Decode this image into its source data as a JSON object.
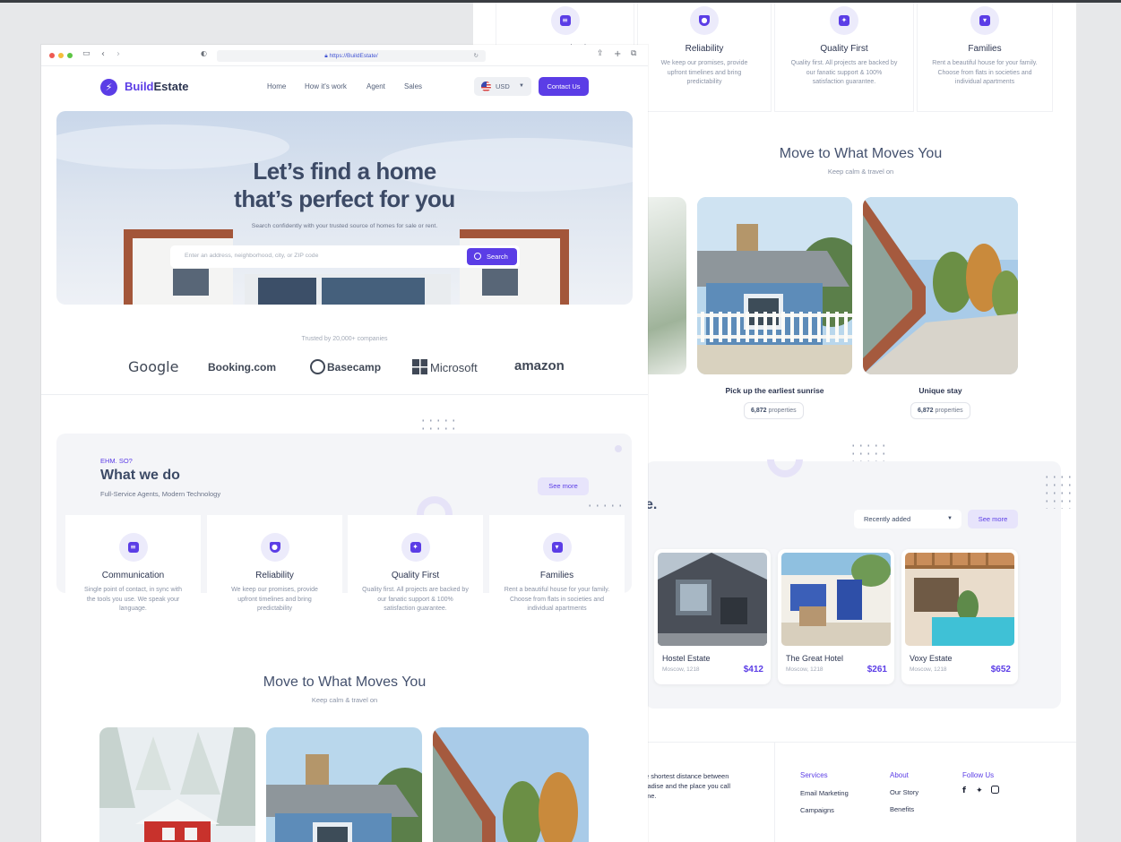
{
  "browser": {
    "url": "https://BuildEstate/"
  },
  "nav": {
    "logo_bold": "Build",
    "logo_rest": "Estate",
    "links": [
      "Home",
      "How it's work",
      "Agent",
      "Sales"
    ],
    "currency": "USD",
    "cta": "Contact Us"
  },
  "hero": {
    "title_line1": "Let’s find a home",
    "title_line2": "that’s perfect for you",
    "subtitle": "Search confidently with your trusted source of homes for sale or rent.",
    "search_placeholder": "Enter an address, neighborhood, city, or ZIP code",
    "search_button": "Search"
  },
  "trusted": {
    "label": "Trusted by 20,000+ companies",
    "brands": [
      "Google",
      "Booking.com",
      "Basecamp",
      "Microsoft",
      "amazon"
    ]
  },
  "what_we_do": {
    "eyebrow": "EHM. SO?",
    "title": "What we do",
    "subtitle": "Full-Service Agents, Modern Technology",
    "see_more": "See more",
    "features": [
      {
        "title": "Communication",
        "text": "Single point of contact, in sync with the tools you use. We speak your language.",
        "icon": "chat-icon"
      },
      {
        "title": "Reliability",
        "text": "We keep our promises, provide upfront timelines and bring predictability",
        "icon": "shield-icon"
      },
      {
        "title": "Quality First",
        "text": "Quality first. All projects are backed by our fanatic support & 100% satisfaction guarantee.",
        "icon": "magic-wand-icon"
      },
      {
        "title": "Families",
        "text": "Rent a beautiful house for your family. Choose from flats in societies and individual apartments",
        "icon": "family-icon"
      }
    ]
  },
  "moves": {
    "title": "Move to What Moves You",
    "subtitle": "Keep calm & travel on",
    "items": [
      {
        "caption": "Pick up the earliest sunrise",
        "count": "6,872",
        "unit": "properties"
      },
      {
        "caption": "Unique stay",
        "count": "6,872",
        "unit": "properties"
      }
    ]
  },
  "listings": {
    "title_fragment": "e.",
    "sort": "Recently added",
    "see_more": "See more",
    "items": [
      {
        "name": "Hostel Estate",
        "location": "Moscow, 1218",
        "price": "$412"
      },
      {
        "name": "The Great Hotel",
        "location": "Moscow, 1218",
        "price": "$261"
      },
      {
        "name": "Voxy Estate",
        "location": "Moscow, 1218",
        "price": "$652"
      }
    ]
  },
  "footer": {
    "blurb_l1": "e shortest distance between",
    "blurb_l2": "radise and the place you call",
    "blurb_l3": "me.",
    "services_h": "Services",
    "services": [
      "Email Marketing",
      "Campaigns"
    ],
    "about_h": "About",
    "about": [
      "Our Story",
      "Benefits"
    ],
    "follow_h": "Follow Us",
    "social": [
      "facebook-icon",
      "twitter-icon",
      "instagram-icon"
    ]
  },
  "colors": {
    "accent": "#5b3de6",
    "text": "#3d4b66",
    "muted": "#8a93a6"
  }
}
